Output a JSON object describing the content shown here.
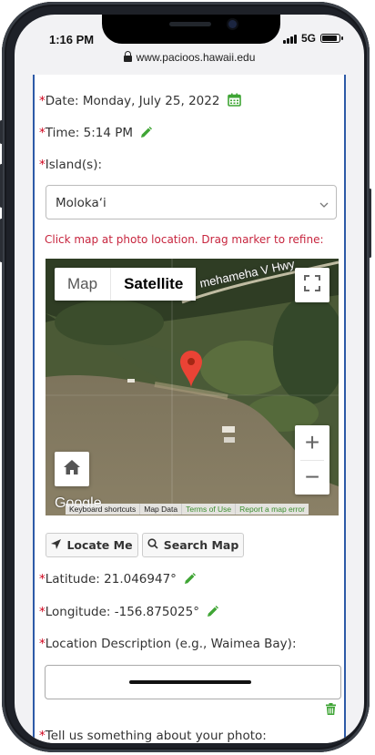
{
  "status": {
    "time": "1:16 PM",
    "network": "5G"
  },
  "browser": {
    "url": "www.pacioos.hawaii.edu"
  },
  "form": {
    "required_mark": "*",
    "date_label": "Date: Monday, July 25, 2022",
    "time_label": "Time: 5:14 PM",
    "island_label": "Island(s):",
    "island_value": "Moloka‘i",
    "map_hint": "Click map at photo location. Drag marker to refine:",
    "latitude_label": "Latitude: 21.046947°",
    "longitude_label": "Longitude: -156.875025°",
    "location_desc_label": "Location Description (e.g., Waimea Bay):",
    "location_desc_value": "",
    "tell_us_label": "Tell us something about your photo:"
  },
  "map": {
    "type_map": "Map",
    "type_satellite": "Satellite",
    "active_type": "Satellite",
    "road_label": "mehameha V Hwy",
    "logo": "Google",
    "attribution": [
      "Keyboard shortcuts",
      "Map Data",
      "Terms of Use",
      "Report a map error"
    ],
    "zoom_in": "+",
    "zoom_out": "−"
  },
  "buttons": {
    "locate": "Locate Me",
    "search": "Search Map"
  },
  "icons": {
    "calendar": "calendar-icon",
    "pencil": "pencil-icon",
    "chevron": "chevron-down-icon",
    "fullscreen": "fullscreen-icon",
    "home": "home-icon",
    "marker": "map-marker-icon",
    "locate": "location-arrow-icon",
    "search": "search-icon",
    "trash": "trash-icon"
  },
  "colors": {
    "accent_green": "#3fa535",
    "required_red": "#d0021b",
    "hint_red": "#c7253e",
    "page_border": "#2d5aa7"
  }
}
